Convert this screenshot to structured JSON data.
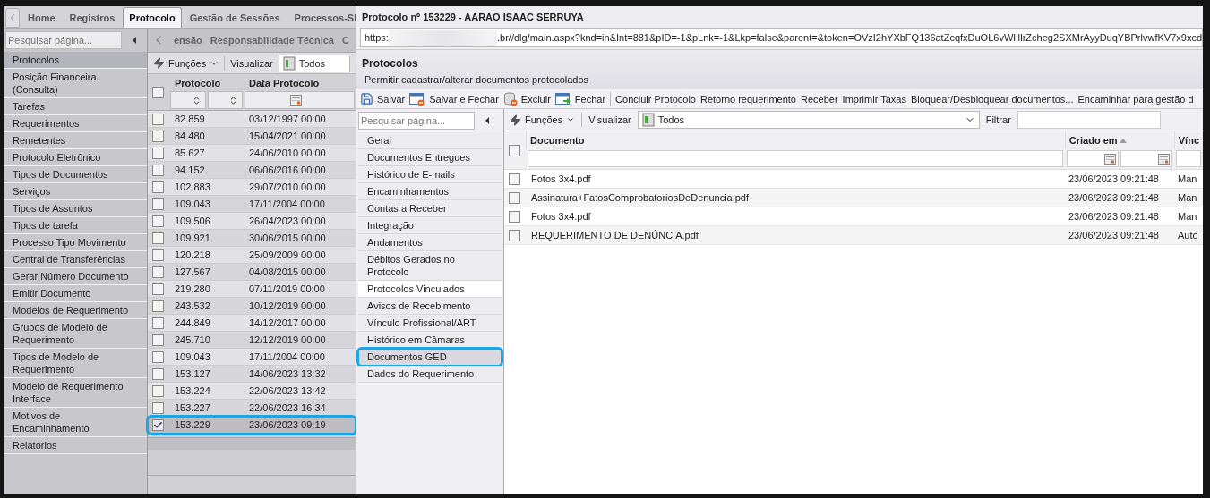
{
  "app_tabs": [
    {
      "label": "Home",
      "selected": false
    },
    {
      "label": "Registros",
      "selected": false
    },
    {
      "label": "Protocolo",
      "selected": true
    },
    {
      "label": "Gestão de Sessões",
      "selected": false
    },
    {
      "label": "Processos-SI",
      "selected": false
    }
  ],
  "sidebar": {
    "search_placeholder": "Pesquisar página...",
    "items": [
      {
        "label": "Protocolos",
        "selected": true
      },
      {
        "label": "Posição Financeira (Consulta)",
        "selected": false
      },
      {
        "label": "Tarefas",
        "selected": false
      },
      {
        "label": "Requerimentos",
        "selected": false
      },
      {
        "label": "Remetentes",
        "selected": false
      },
      {
        "label": "Protocolo Eletrônico",
        "selected": false
      },
      {
        "label": "Tipos de Documentos",
        "selected": false
      },
      {
        "label": "Serviços",
        "selected": false
      },
      {
        "label": "Tipos de Assuntos",
        "selected": false
      },
      {
        "label": "Tipos de tarefa",
        "selected": false
      },
      {
        "label": "Processo Tipo Movimento",
        "selected": false
      },
      {
        "label": "Central de Transferências",
        "selected": false
      },
      {
        "label": "Gerar Número Documento",
        "selected": false
      },
      {
        "label": "Emitir Documento",
        "selected": false
      },
      {
        "label": "Modelos de Requerimento",
        "selected": false
      },
      {
        "label": "Grupos de Modelo de Requerimento",
        "selected": false
      },
      {
        "label": "Tipos de Modelo de Requerimento",
        "selected": false
      },
      {
        "label": "Modelo de Requerimento Interface",
        "selected": false
      },
      {
        "label": "Motivos de Encaminhamento",
        "selected": false
      },
      {
        "label": "Relatórios",
        "selected": false
      }
    ]
  },
  "subtabs": [
    "ensão",
    "Responsabilidade Técnica",
    "C"
  ],
  "toolbar": {
    "functions": "Funções",
    "view_label": "Visualizar",
    "view_value": "Todos"
  },
  "table": {
    "all_checked": false,
    "columns": [
      "Protocolo",
      "Data Protocolo"
    ],
    "rows": [
      {
        "protocolo": "82.859",
        "data": "03/12/1997 00:00",
        "checked": false,
        "highlighted": false
      },
      {
        "protocolo": "84.480",
        "data": "15/04/2021 00:00",
        "checked": false,
        "highlighted": false
      },
      {
        "protocolo": "85.627",
        "data": "24/06/2010 00:00",
        "checked": false,
        "highlighted": false
      },
      {
        "protocolo": "94.152",
        "data": "06/06/2016 00:00",
        "checked": false,
        "highlighted": false
      },
      {
        "protocolo": "102.883",
        "data": "29/07/2010 00:00",
        "checked": false,
        "highlighted": false
      },
      {
        "protocolo": "109.043",
        "data": "17/11/2004 00:00",
        "checked": false,
        "highlighted": false
      },
      {
        "protocolo": "109.506",
        "data": "26/04/2023 00:00",
        "checked": false,
        "highlighted": false
      },
      {
        "protocolo": "109.921",
        "data": "30/06/2015 00:00",
        "checked": false,
        "highlighted": false
      },
      {
        "protocolo": "120.218",
        "data": "25/09/2009 00:00",
        "checked": false,
        "highlighted": false
      },
      {
        "protocolo": "127.567",
        "data": "04/08/2015 00:00",
        "checked": false,
        "highlighted": false
      },
      {
        "protocolo": "219.280",
        "data": "07/11/2019 00:00",
        "checked": false,
        "highlighted": false
      },
      {
        "protocolo": "243.532",
        "data": "10/12/2019 00:00",
        "checked": false,
        "highlighted": false
      },
      {
        "protocolo": "244.849",
        "data": "14/12/2017 00:00",
        "checked": false,
        "highlighted": false
      },
      {
        "protocolo": "245.710",
        "data": "12/12/2019 00:00",
        "checked": false,
        "highlighted": false
      },
      {
        "protocolo": "109.043",
        "data": "17/11/2004 00:00",
        "checked": false,
        "highlighted": false
      },
      {
        "protocolo": "153.127",
        "data": "14/06/2023 13:32",
        "checked": false,
        "highlighted": false
      },
      {
        "protocolo": "153.224",
        "data": "22/06/2023 13:42",
        "checked": false,
        "highlighted": false
      },
      {
        "protocolo": "153.227",
        "data": "22/06/2023 16:34",
        "checked": false,
        "highlighted": false
      },
      {
        "protocolo": "153.229",
        "data": "23/06/2023 09:19",
        "checked": true,
        "highlighted": true
      }
    ]
  },
  "dialog": {
    "title": "Protocolo nº 153229 - AARAO ISAAC SERRUYA",
    "url": {
      "scheme": "https:",
      "rest": ".br//dlg/main.aspx?knd=in&Int=881&pID=-1&pLnk=-1&Lkp=false&parent=&token=OVzI2hYXbFQ136atZcqfxDuOL6vWHlrZcheg2SXMrAyyDuqYBPrlvwfKV7x9xcd"
    },
    "section_title": "Protocolos",
    "section_subtitle": "Permitir cadastrar/alterar documentos protocolados",
    "actions": [
      {
        "label": "Salvar",
        "kind": "save"
      },
      {
        "label": "Salvar e Fechar",
        "kind": "save_close"
      },
      {
        "label": "Excluir",
        "kind": "delete"
      },
      {
        "label": "Fechar",
        "kind": "close"
      },
      {
        "label": "Concluir Protocolo",
        "kind": "text"
      },
      {
        "label": "Retorno requerimento",
        "kind": "text"
      },
      {
        "label": "Receber",
        "kind": "text"
      },
      {
        "label": "Imprimir Taxas",
        "kind": "text"
      },
      {
        "label": "Bloquear/Desbloquear documentos...",
        "kind": "text"
      },
      {
        "label": "Encaminhar para gestão d",
        "kind": "text"
      }
    ],
    "nav": {
      "search_placeholder": "Pesquisar página...",
      "items": [
        {
          "label": "Geral",
          "selected": false,
          "hovered": false,
          "highlighted": false
        },
        {
          "label": "Documentos Entregues",
          "selected": false,
          "hovered": false,
          "highlighted": false
        },
        {
          "label": "Histórico de E-mails",
          "selected": false,
          "hovered": false,
          "highlighted": false
        },
        {
          "label": "Encaminhamentos",
          "selected": false,
          "hovered": false,
          "highlighted": false
        },
        {
          "label": "Contas a Receber",
          "selected": false,
          "hovered": false,
          "highlighted": false
        },
        {
          "label": "Integração",
          "selected": false,
          "hovered": false,
          "highlighted": false
        },
        {
          "label": "Andamentos",
          "selected": false,
          "hovered": false,
          "highlighted": false
        },
        {
          "label": "Débitos Gerados no Protocolo",
          "selected": false,
          "hovered": false,
          "highlighted": false
        },
        {
          "label": "Protocolos Vinculados",
          "selected": false,
          "hovered": true,
          "highlighted": false
        },
        {
          "label": "Avisos de Recebimento",
          "selected": false,
          "hovered": false,
          "highlighted": false
        },
        {
          "label": "Vínculo Profissional/ART",
          "selected": false,
          "hovered": false,
          "highlighted": false
        },
        {
          "label": "Histórico em Câmaras",
          "selected": false,
          "hovered": false,
          "highlighted": false
        },
        {
          "label": "Documentos GED",
          "selected": true,
          "hovered": false,
          "highlighted": true
        },
        {
          "label": "Dados do Requerimento",
          "selected": false,
          "hovered": false,
          "highlighted": false
        }
      ]
    },
    "grid": {
      "toolbar": {
        "functions": "Funções",
        "view_label": "Visualizar",
        "view_value": "Todos",
        "filter_label": "Filtrar"
      },
      "all_checked": false,
      "columns": [
        {
          "label": "Documento",
          "sorted_ascending": false
        },
        {
          "label": "Criado em",
          "sorted_ascending": true
        },
        {
          "label": "Vínc",
          "sorted_ascending": false
        }
      ],
      "rows": [
        {
          "documento": "Fotos 3x4.pdf",
          "criado_em": "23/06/2023 09:21:48",
          "column_3": "Man",
          "checked": false
        },
        {
          "documento": "Assinatura+FatosComprobatoriosDeDenuncia.pdf",
          "criado_em": "23/06/2023 09:21:48",
          "column_3": "Man",
          "checked": false
        },
        {
          "documento": "Fotos 3x4.pdf",
          "criado_em": "23/06/2023 09:21:48",
          "column_3": "Man",
          "checked": false
        },
        {
          "documento": "REQUERIMENTO DE DENÚNCIA.pdf",
          "criado_em": "23/06/2023 09:21:48",
          "column_3": "Auto",
          "checked": false
        }
      ]
    }
  }
}
